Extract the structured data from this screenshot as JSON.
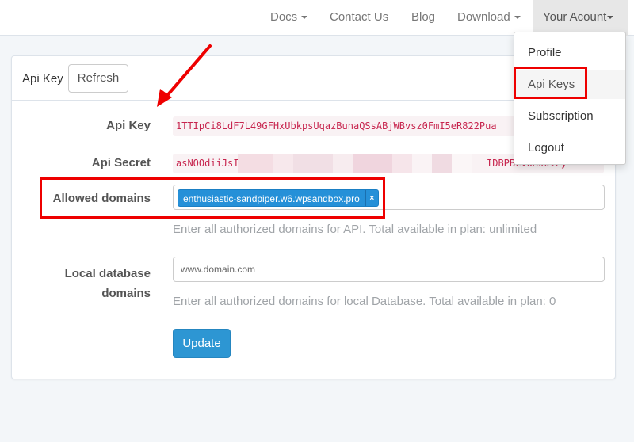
{
  "navbar": {
    "items": [
      {
        "label": "Docs",
        "has_caret": true
      },
      {
        "label": "Contact Us",
        "has_caret": false
      },
      {
        "label": "Blog",
        "has_caret": false
      },
      {
        "label": "Download",
        "has_caret": true
      },
      {
        "label": "Your Acount",
        "has_caret": true,
        "active": true
      }
    ]
  },
  "account_dropdown": {
    "items": [
      {
        "label": "Profile"
      },
      {
        "label": "Api Keys",
        "highlighted": true
      },
      {
        "label": "Subscription"
      },
      {
        "label": "Logout"
      }
    ]
  },
  "panel": {
    "title": "Api Key",
    "refresh_label": "Refresh",
    "fields": {
      "api_key": {
        "label": "Api Key",
        "value": "1TTIpCi8LdF7L49GFHxUbkpsUqazBunaQSsABjWBvsz0FmI5eR822Pua"
      },
      "api_secret": {
        "label": "Api Secret",
        "value_start": "asNOOdiiJsI",
        "value_end": "IDBPBcvoRxxvZy"
      },
      "allowed_domains": {
        "label": "Allowed domains",
        "tags": [
          "enthusiastic-sandpiper.w6.wpsandbox.pro"
        ],
        "tag_remove": "×",
        "help": "Enter all authorized domains for API. Total available in plan: unlimited"
      },
      "local_domains": {
        "label_line1": "Local database",
        "label_line2": "domains",
        "placeholder": "www.domain.com",
        "value": "",
        "help": "Enter all authorized domains for local Database. Total available in plan: 0"
      }
    },
    "update_label": "Update"
  },
  "annotations": {
    "highlight_color": "#ee0000"
  },
  "colors": {
    "primary": "#2d96d3",
    "tag": "#2590d8",
    "code_text": "#c7254e",
    "code_bg": "#f9f2f4",
    "page_bg": "#f3f6f9"
  }
}
